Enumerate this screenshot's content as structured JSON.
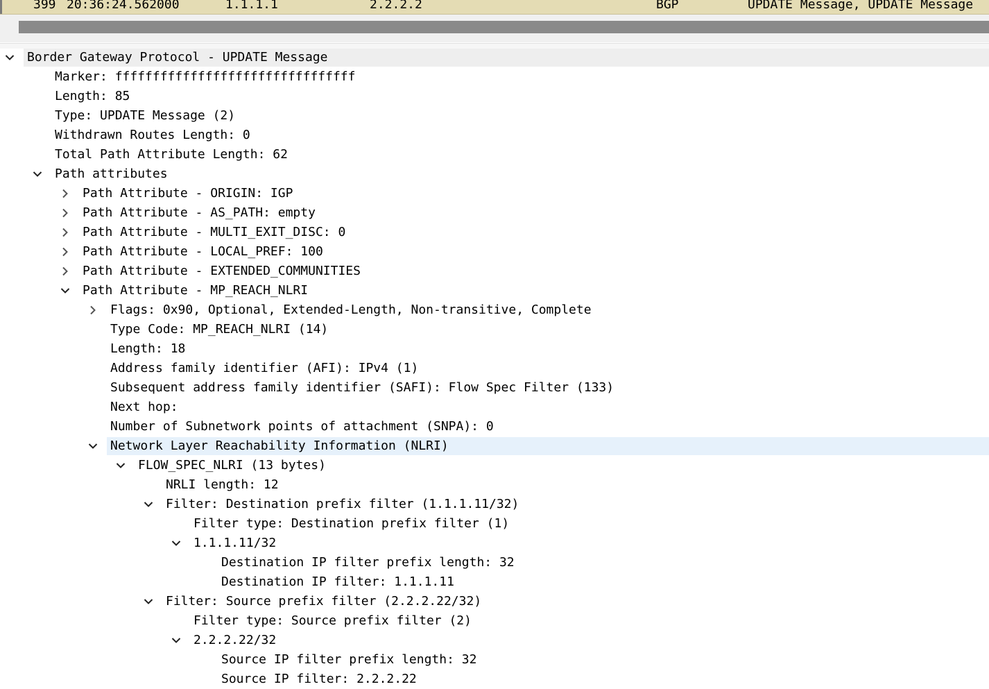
{
  "packet_list": {
    "no": "399",
    "time": "20:36:24.562000",
    "source": "1.1.1.1",
    "destination": "2.2.2.2",
    "protocol": "BGP",
    "info": "UPDATE Message, UPDATE Message"
  },
  "tree": [
    {
      "level": 0,
      "toggle": "expanded",
      "text": "Border Gateway Protocol - UPDATE Message"
    },
    {
      "level": 1,
      "toggle": "none",
      "text": "Marker: ffffffffffffffffffffffffffffffff"
    },
    {
      "level": 1,
      "toggle": "none",
      "text": "Length: 85"
    },
    {
      "level": 1,
      "toggle": "none",
      "text": "Type: UPDATE Message (2)"
    },
    {
      "level": 1,
      "toggle": "none",
      "text": "Withdrawn Routes Length: 0"
    },
    {
      "level": 1,
      "toggle": "none",
      "text": "Total Path Attribute Length: 62"
    },
    {
      "level": 1,
      "toggle": "expanded",
      "text": "Path attributes"
    },
    {
      "level": 2,
      "toggle": "collapsed",
      "text": "Path Attribute - ORIGIN: IGP"
    },
    {
      "level": 2,
      "toggle": "collapsed",
      "text": "Path Attribute - AS_PATH: empty"
    },
    {
      "level": 2,
      "toggle": "collapsed",
      "text": "Path Attribute - MULTI_EXIT_DISC: 0"
    },
    {
      "level": 2,
      "toggle": "collapsed",
      "text": "Path Attribute - LOCAL_PREF: 100"
    },
    {
      "level": 2,
      "toggle": "collapsed",
      "text": "Path Attribute - EXTENDED_COMMUNITIES"
    },
    {
      "level": 2,
      "toggle": "expanded",
      "text": "Path Attribute - MP_REACH_NLRI"
    },
    {
      "level": 3,
      "toggle": "collapsed",
      "text": "Flags: 0x90, Optional, Extended-Length, Non-transitive, Complete"
    },
    {
      "level": 3,
      "toggle": "none",
      "text": "Type Code: MP_REACH_NLRI (14)"
    },
    {
      "level": 3,
      "toggle": "none",
      "text": "Length: 18"
    },
    {
      "level": 3,
      "toggle": "none",
      "text": "Address family identifier (AFI): IPv4 (1)"
    },
    {
      "level": 3,
      "toggle": "none",
      "text": "Subsequent address family identifier (SAFI): Flow Spec Filter (133)"
    },
    {
      "level": 3,
      "toggle": "none",
      "text": "Next hop:"
    },
    {
      "level": 3,
      "toggle": "none",
      "text": "Number of Subnetwork points of attachment (SNPA): 0"
    },
    {
      "level": 3,
      "toggle": "expanded",
      "text": "Network Layer Reachability Information (NLRI)",
      "selected": true
    },
    {
      "level": 4,
      "toggle": "expanded",
      "text": "FLOW_SPEC_NLRI (13 bytes)"
    },
    {
      "level": 5,
      "toggle": "none",
      "text": "NRLI length: 12"
    },
    {
      "level": 5,
      "toggle": "expanded",
      "text": "Filter: Destination prefix filter (1.1.1.11/32)"
    },
    {
      "level": 6,
      "toggle": "none",
      "text": "Filter type: Destination prefix filter (1)"
    },
    {
      "level": 6,
      "toggle": "expanded",
      "text": "1.1.1.11/32"
    },
    {
      "level": 7,
      "toggle": "none",
      "text": "Destination IP filter prefix length: 32"
    },
    {
      "level": 7,
      "toggle": "none",
      "text": "Destination IP filter: 1.1.1.11"
    },
    {
      "level": 5,
      "toggle": "expanded",
      "text": "Filter: Source prefix filter (2.2.2.22/32)"
    },
    {
      "level": 6,
      "toggle": "none",
      "text": "Filter type: Source prefix filter (2)"
    },
    {
      "level": 6,
      "toggle": "expanded",
      "text": "2.2.2.22/32"
    },
    {
      "level": 7,
      "toggle": "none",
      "text": "Source IP filter prefix length: 32"
    },
    {
      "level": 7,
      "toggle": "none",
      "text": "Source IP filter: 2.2.2.22"
    }
  ],
  "icons": {
    "expanded": "chevron-down-icon",
    "collapsed": "chevron-right-icon"
  },
  "colors": {
    "packet_row_bg": "#e4dcb4",
    "selected_row_bg": "#e6f1fb"
  }
}
